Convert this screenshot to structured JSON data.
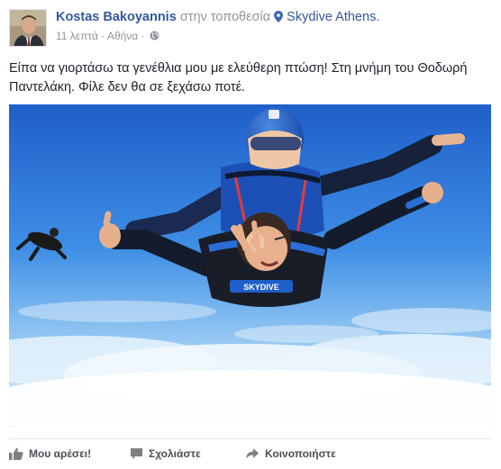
{
  "post": {
    "author": "Kostas Bakoyannis",
    "at_text": "στην τοποθεσία",
    "location": "Skydive Athens.",
    "timestamp": "11 λεπτά",
    "separator": "·",
    "city": "Αθήνα",
    "separator_2": "·",
    "privacy_icon": "globe-icon",
    "location_icon": "map-pin-icon",
    "text": "Είπα να γιορτάσω τα γενέθλια μου με ελεύθερη πτώση! Στη μνήμη του Θοδωρή Παντελάκη. Φίλε δεν θα σε ξεχάσω ποτέ.",
    "photo_print": "SKYDIVE"
  },
  "actions": {
    "like_label": "Μου αρέσει!",
    "like_icon": "thumbs-up-icon",
    "comment_label": "Σχολιάστε",
    "comment_icon": "comment-icon",
    "share_label": "Κοινοποιήστε",
    "share_icon": "share-icon"
  },
  "colors": {
    "link": "#365899",
    "meta": "#90949c",
    "text": "#1d2129",
    "action": "#4b4f56"
  }
}
